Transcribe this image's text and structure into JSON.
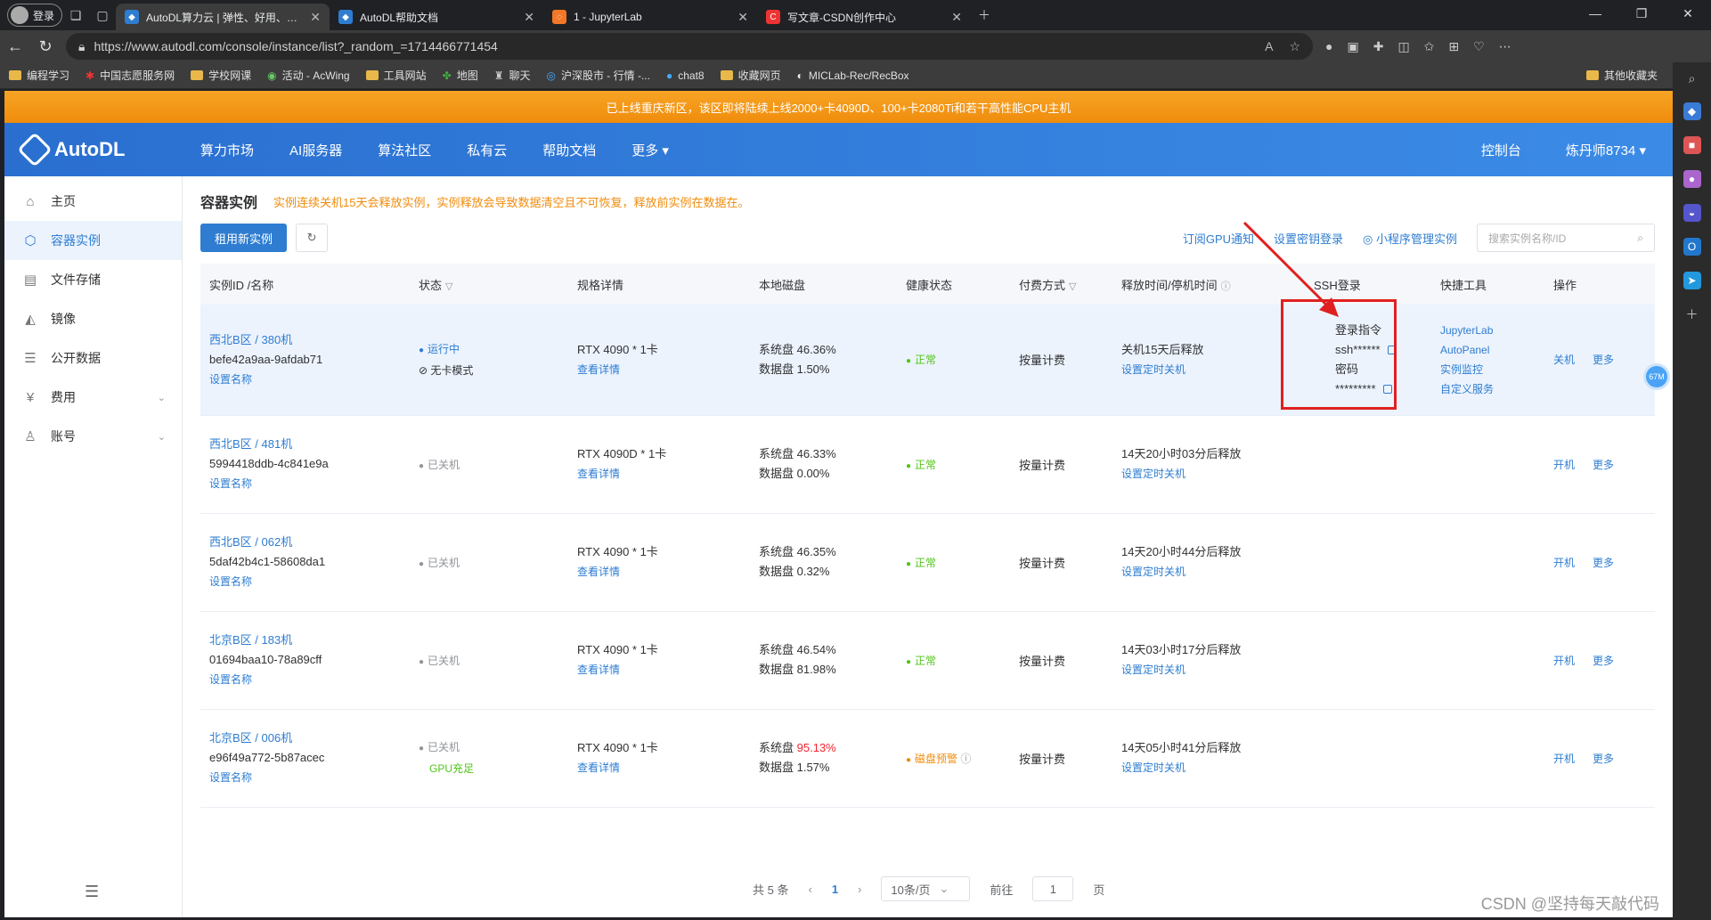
{
  "browser": {
    "profile": "登录",
    "tabs": [
      {
        "title": "AutoDL算力云 | 弹性、好用、省钱...",
        "active": true
      },
      {
        "title": "AutoDL帮助文档",
        "active": false
      },
      {
        "title": "1 - JupyterLab",
        "active": false
      },
      {
        "title": "写文章-CSDN创作中心",
        "active": false
      }
    ],
    "url": "https://www.autodl.com/console/instance/list?_random_=1714466771454",
    "bookmarks": [
      "编程学习",
      "中国志愿服务网",
      "学校网课",
      "活动 - AcWing",
      "工具网站",
      "地图",
      "聊天",
      "沪深股市 - 行情 -...",
      "chat8",
      "收藏网页",
      "MICLab-Rec/RecBox"
    ],
    "bookmarks_other": "其他收藏夹"
  },
  "banner": "已上线重庆新区，该区即将陆续上线2000+卡4090D、100+卡2080Ti和若干高性能CPU主机",
  "topnav": {
    "logo": "AutoDL",
    "items": [
      "算力市场",
      "AI服务器",
      "算法社区",
      "私有云",
      "帮助文档",
      "更多 ▾"
    ],
    "console": "控制台",
    "user": "炼丹师8734 ▾"
  },
  "sidebar": {
    "items": [
      {
        "label": "主页",
        "icon": "home-icon"
      },
      {
        "label": "容器实例",
        "icon": "container-icon"
      },
      {
        "label": "文件存储",
        "icon": "storage-icon"
      },
      {
        "label": "镜像",
        "icon": "image-icon"
      },
      {
        "label": "公开数据",
        "icon": "database-icon"
      },
      {
        "label": "费用",
        "icon": "yen-icon"
      },
      {
        "label": "账号",
        "icon": "user-icon"
      }
    ]
  },
  "main": {
    "title": "容器实例",
    "warning": "实例连续关机15天会释放实例，实例释放会导致数据清空且不可恢复，释放前实例在数据在。",
    "rent_button": "租用新实例",
    "links": [
      "订阅GPU通知",
      "设置密钥登录",
      "小程序管理实例"
    ],
    "search_placeholder": "搜索实例名称/ID",
    "headers": [
      "实例ID /名称",
      "状态",
      "规格详情",
      "本地磁盘",
      "健康状态",
      "付费方式",
      "释放时间/停机时间",
      "SSH登录",
      "快捷工具",
      "操作"
    ],
    "rows": [
      {
        "region": "西北B区 / 380机",
        "id": "befe42a9aa-9afdab71",
        "set_name": "设置名称",
        "status": "运行中",
        "status2": "无卡模式",
        "spec": "RTX 4090 * 1卡",
        "detail": "查看详情",
        "sys_disk": "系统盘 46.36%",
        "data_disk": "数据盘 1.50%",
        "health": "正常",
        "billing": "按量计费",
        "release": "关机15天后释放",
        "timer": "设置定时关机",
        "ssh_cmd_label": "登录指令",
        "ssh_cmd": "ssh******",
        "ssh_pwd_label": "密码",
        "ssh_pwd": "*********",
        "tools": [
          "JupyterLab",
          "AutoPanel",
          "实例监控",
          "自定义服务"
        ],
        "op1": "关机",
        "op2": "更多"
      },
      {
        "region": "西北B区 / 481机",
        "id": "5994418ddb-4c841e9a",
        "set_name": "设置名称",
        "status": "已关机",
        "status2": "",
        "spec": "RTX 4090D * 1卡",
        "detail": "查看详情",
        "sys_disk": "系统盘 46.33%",
        "data_disk": "数据盘 0.00%",
        "health": "正常",
        "billing": "按量计费",
        "release": "14天20小时03分后释放",
        "timer": "设置定时关机",
        "op1": "开机",
        "op2": "更多"
      },
      {
        "region": "西北B区 / 062机",
        "id": "5daf42b4c1-58608da1",
        "set_name": "设置名称",
        "status": "已关机",
        "status2": "",
        "spec": "RTX 4090 * 1卡",
        "detail": "查看详情",
        "sys_disk": "系统盘 46.35%",
        "data_disk": "数据盘 0.32%",
        "health": "正常",
        "billing": "按量计费",
        "release": "14天20小时44分后释放",
        "timer": "设置定时关机",
        "op1": "开机",
        "op2": "更多"
      },
      {
        "region": "北京B区 / 183机",
        "id": "01694baa10-78a89cff",
        "set_name": "设置名称",
        "status": "已关机",
        "status2": "",
        "spec": "RTX 4090 * 1卡",
        "detail": "查看详情",
        "sys_disk": "系统盘 46.54%",
        "data_disk": "数据盘 81.98%",
        "health": "正常",
        "billing": "按量计费",
        "release": "14天03小时17分后释放",
        "timer": "设置定时关机",
        "op1": "开机",
        "op2": "更多"
      },
      {
        "region": "北京B区 / 006机",
        "id": "e96f49a772-5b87acec",
        "set_name": "设置名称",
        "status": "已关机",
        "status2": "GPU充足",
        "spec": "RTX 4090 * 1卡",
        "detail": "查看详情",
        "sys_disk_label": "系统盘",
        "sys_disk_value": "95.13%",
        "data_disk": "数据盘 1.57%",
        "health": "磁盘预警",
        "billing": "按量计费",
        "release": "14天05小时41分后释放",
        "timer": "设置定时关机",
        "op1": "开机",
        "op2": "更多"
      }
    ],
    "pager": {
      "total": "共 5 条",
      "page": "1",
      "size": "10条/页",
      "goto_label": "前往",
      "goto_value": "1",
      "page_unit": "页"
    }
  },
  "fab": "67M",
  "watermark": "CSDN @坚持每天敲代码",
  "colors": {
    "brand": "#2e7dd1",
    "banner": "#f39c12",
    "highlight": "#e02020"
  }
}
